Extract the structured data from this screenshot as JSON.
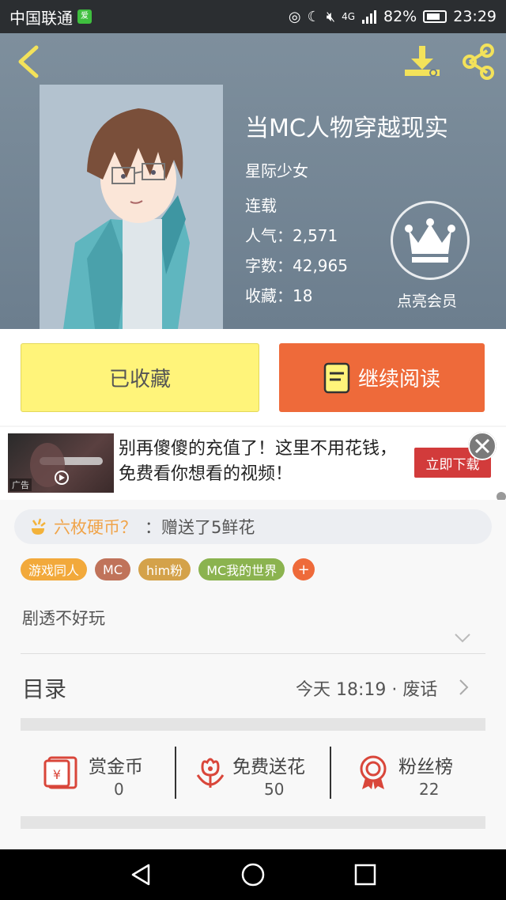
{
  "status_bar": {
    "carrier": "中国联通",
    "app_badge": "iQIY",
    "network": "4G",
    "battery": "82%",
    "time": "23:29"
  },
  "book": {
    "title": "当MC人物穿越现实",
    "author": "星际少女",
    "status": "连载",
    "popularity": "人气：2,571",
    "word_count": "字数：42,965",
    "favorites": "收藏：18",
    "vip_label": "点亮会员"
  },
  "actions": {
    "collected_label": "已收藏",
    "read_label": "继续阅读"
  },
  "ad": {
    "text": "别再傻傻的充值了！这里不用花钱，免费看你想看的视频！",
    "button": "立即下载",
    "tag": "广告"
  },
  "gift": {
    "user": "六枚硬币？",
    "text": "：赠送了5鲜花"
  },
  "tags": [
    {
      "label": "游戏同人",
      "color": "#f2a93b"
    },
    {
      "label": "MC",
      "color": "#c0735a"
    },
    {
      "label": "him粉",
      "color": "#d4a24a"
    },
    {
      "label": "MC我的世界",
      "color": "#8bb34f"
    }
  ],
  "tag_add": "+",
  "description": "剧透不好玩",
  "toc": {
    "label": "目录",
    "latest": "今天 18:19 · 废话"
  },
  "stats": {
    "reward": {
      "title": "赏金币",
      "value": "0"
    },
    "flowers": {
      "title": "免费送花",
      "value": "50"
    },
    "fans": {
      "title": "粉丝榜",
      "value": "22"
    }
  },
  "colors": {
    "accent_orange": "#ee6a3a",
    "collected_yellow": "#fff47a",
    "icon_red": "#d9463a",
    "header_icon_yellow": "#f3e25a"
  }
}
